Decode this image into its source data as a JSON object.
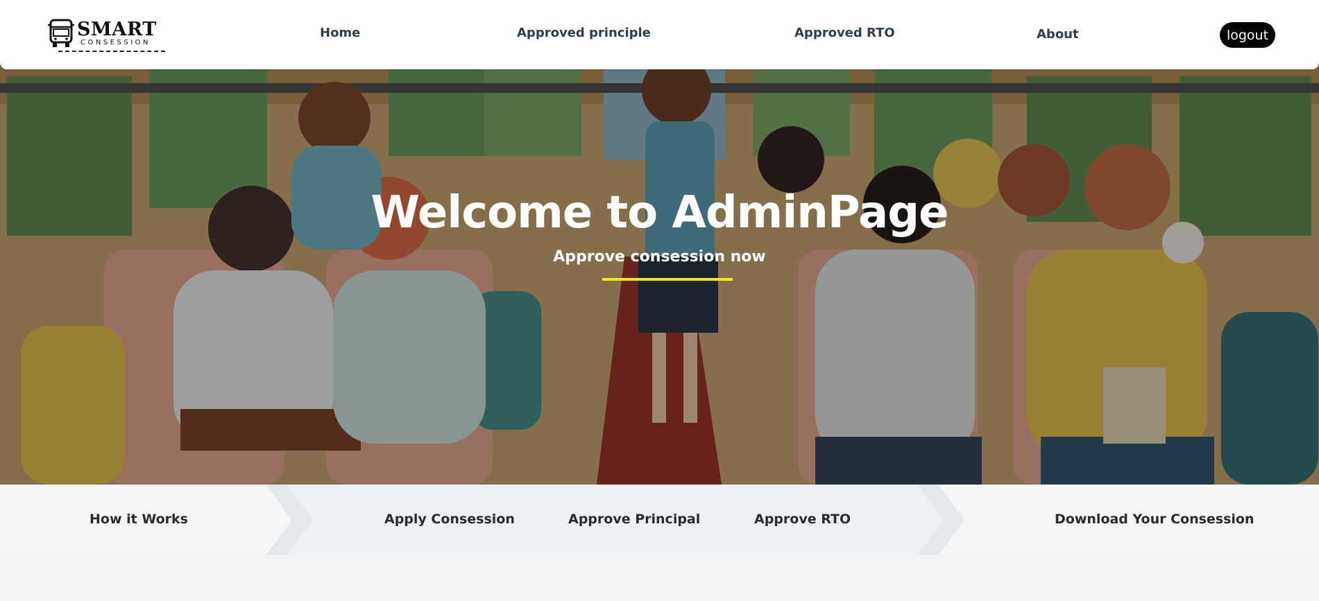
{
  "brand": {
    "name": "SMART",
    "tagline": "CONSESSION",
    "icon": "bus-icon"
  },
  "nav": {
    "items": [
      {
        "label": "Home"
      },
      {
        "label": "Approved principle"
      },
      {
        "label": "Approved RTO"
      },
      {
        "label": "About"
      }
    ],
    "logout_label": "logout"
  },
  "hero": {
    "title": "Welcome to AdminPage",
    "subtitle": "Approve consession now",
    "underline_color": "#f2ea1d",
    "illustration": "school-bus-children-illustration"
  },
  "steps": {
    "items": [
      {
        "label": "How it Works"
      },
      {
        "label": "Apply Consession"
      },
      {
        "label": "Approve Principal"
      },
      {
        "label": "Approve RTO"
      },
      {
        "label": "Download Your Consession"
      }
    ]
  },
  "colors": {
    "nav_text": "#2c3e50",
    "logout_bg": "#000000",
    "steps_bg": "#f3f5f7"
  }
}
